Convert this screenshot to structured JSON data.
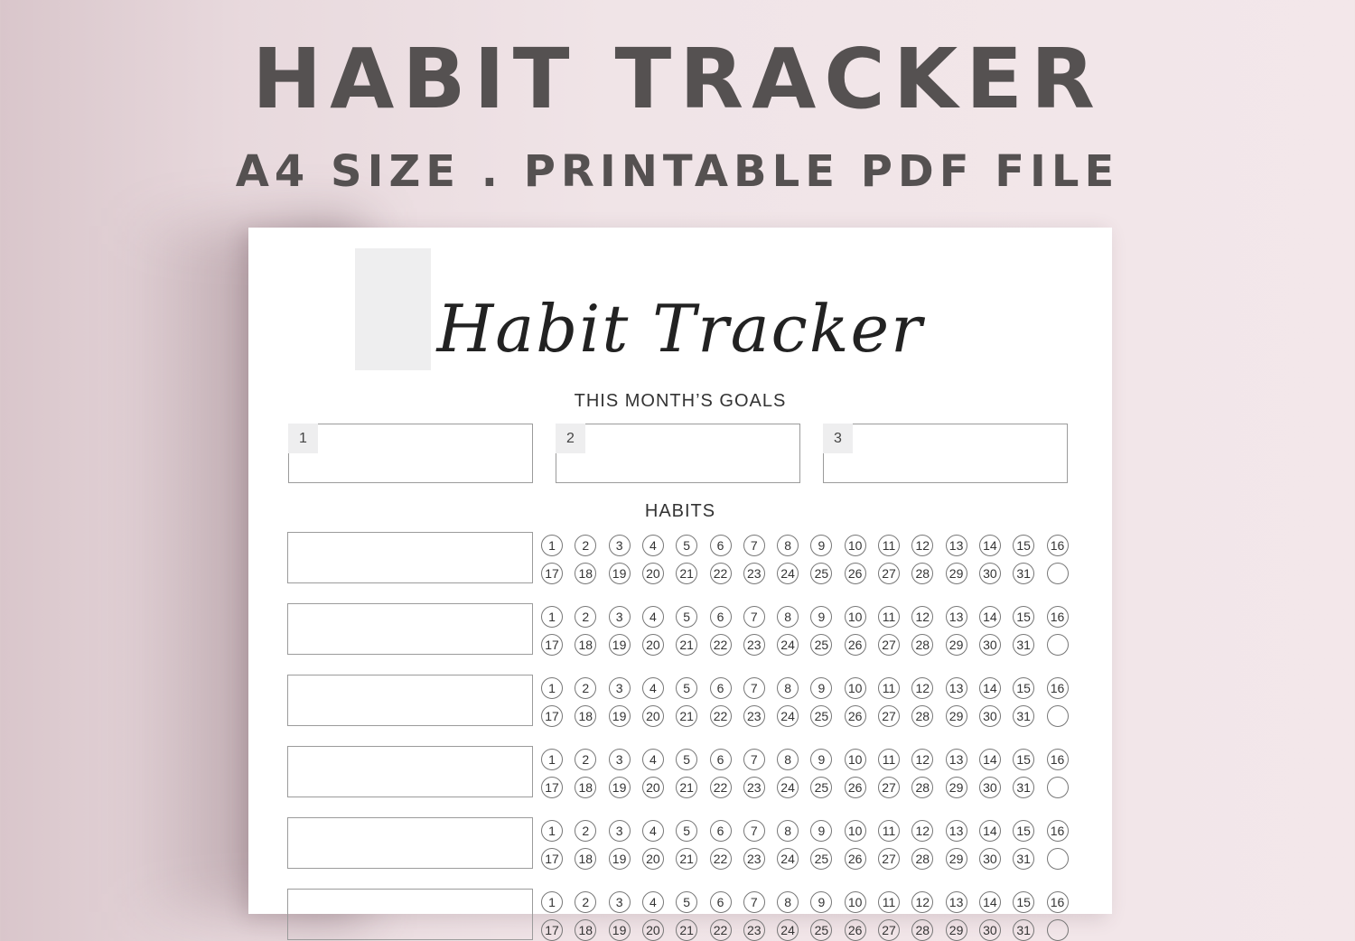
{
  "banner": {
    "title": "HABIT TRACKER",
    "subtitle": "A4 SIZE . PRINTABLE PDF FILE"
  },
  "sheet": {
    "script_title": "Habit Tracker",
    "goals_label": "THIS MONTH’S GOALS",
    "goal_numbers": [
      "1",
      "2",
      "3"
    ],
    "habits_label": "HABITS",
    "days_row1": [
      "1",
      "2",
      "3",
      "4",
      "5",
      "6",
      "7",
      "8",
      "9",
      "10",
      "11",
      "12",
      "13",
      "14",
      "15",
      "16"
    ],
    "days_row2": [
      "17",
      "18",
      "19",
      "20",
      "21",
      "22",
      "23",
      "24",
      "25",
      "26",
      "27",
      "28",
      "29",
      "30",
      "31",
      ""
    ],
    "habit_count": 6
  }
}
